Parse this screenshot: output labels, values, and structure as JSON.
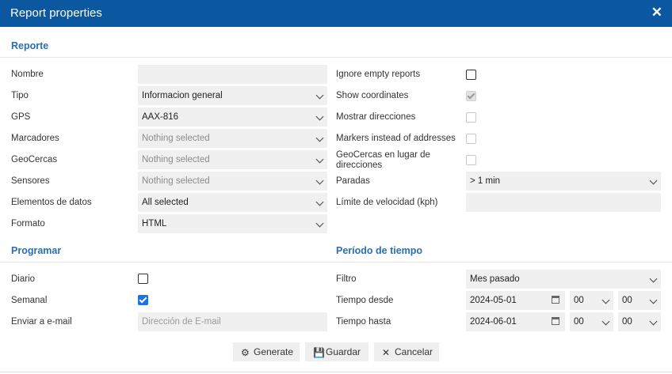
{
  "window": {
    "title": "Report properties",
    "close_icon": "✕"
  },
  "sections": {
    "reporte": "Reporte",
    "programar": "Programar",
    "periodo": "Período de tiempo"
  },
  "left": {
    "nombre": {
      "label": "Nombre",
      "value": ""
    },
    "tipo": {
      "label": "Tipo",
      "value": "Informacion general"
    },
    "gps": {
      "label": "GPS",
      "value": "AAX-816"
    },
    "marcadores": {
      "label": "Marcadores",
      "value": "Nothing selected"
    },
    "geocercas": {
      "label": "GeoCercas",
      "value": "Nothing selected"
    },
    "sensores": {
      "label": "Sensores",
      "value": "Nothing selected"
    },
    "elementos": {
      "label": "Elementos de datos",
      "value": "All selected"
    },
    "formato": {
      "label": "Formato",
      "value": "HTML"
    }
  },
  "right": {
    "ignore_empty": {
      "label": "Ignore empty reports",
      "checked": false
    },
    "show_coordinates": {
      "label": "Show coordinates",
      "checked": true
    },
    "mostrar_direcciones": {
      "label": "Mostrar direcciones",
      "checked": false
    },
    "markers_instead": {
      "label": "Markers instead of addresses",
      "checked": false
    },
    "geocercas_lugar": {
      "label_line1": "GeoCercas en lugar de",
      "label_line2": "direcciones",
      "checked": false
    },
    "paradas": {
      "label": "Paradas",
      "value": "> 1 min"
    },
    "limite_velocidad": {
      "label": "Límite de velocidad (kph)",
      "value": ""
    }
  },
  "programar": {
    "diario": {
      "label": "Diario",
      "checked": false
    },
    "semanal": {
      "label": "Semanal",
      "checked": true
    },
    "email": {
      "label": "Enviar a e-mail",
      "placeholder": "Dirección de E-mail"
    }
  },
  "periodo": {
    "filtro": {
      "label": "Filtro",
      "value": "Mes pasado"
    },
    "desde": {
      "label": "Tiempo desde",
      "date": "2024-05-01",
      "hour": "00",
      "minute": "00"
    },
    "hasta": {
      "label": "Tiempo hasta",
      "date": "2024-06-01",
      "hour": "00",
      "minute": "00"
    }
  },
  "buttons": {
    "generate": "Generate",
    "guardar": "Guardar",
    "cancelar": "Cancelar"
  },
  "colors": {
    "titlebar": "#0b58a0",
    "section": "#2a6fb5",
    "accent": "#1a73e8"
  }
}
